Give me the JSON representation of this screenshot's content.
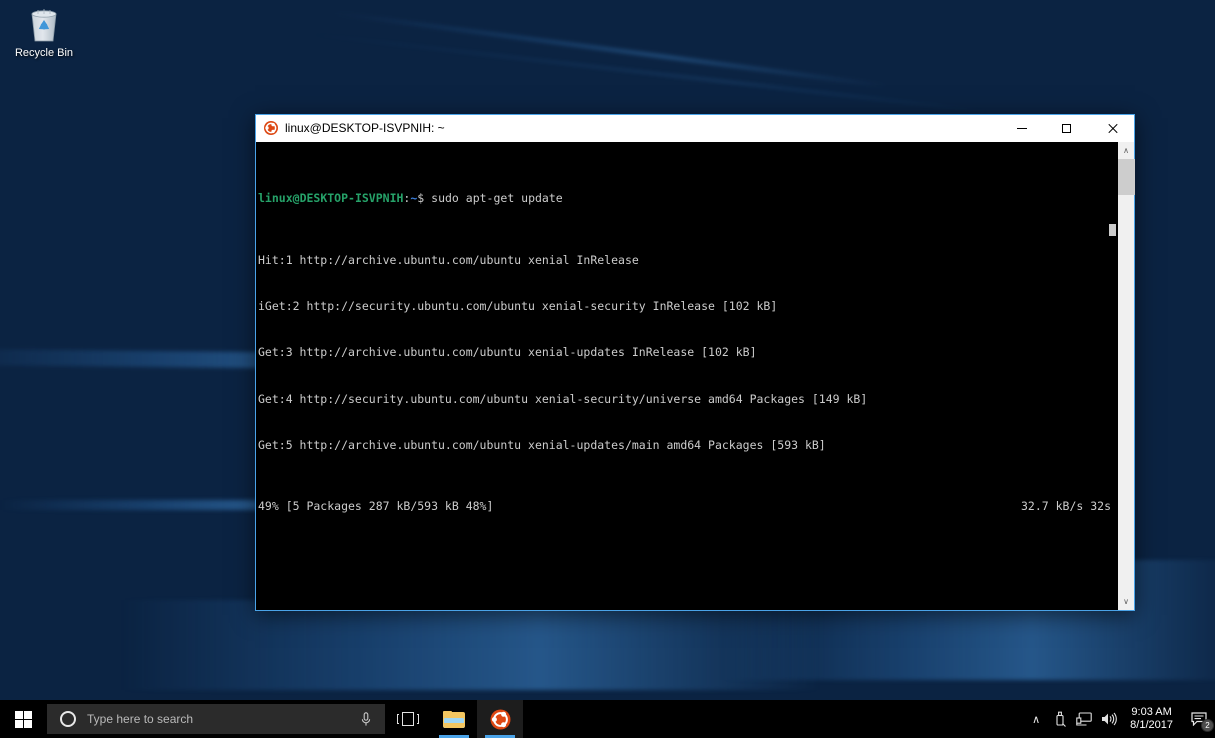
{
  "desktop": {
    "icons": [
      {
        "name": "recycle-bin",
        "label": "Recycle Bin"
      }
    ]
  },
  "window": {
    "title": "linux@DESKTOP-ISVPNIH: ~",
    "app_icon": "ubuntu-icon",
    "controls": {
      "minimize": "—",
      "maximize": "❑",
      "close": "✕"
    },
    "border_color": "#4aa3e8"
  },
  "terminal": {
    "background": "#000000",
    "foreground": "#cccccc",
    "prompt": {
      "user": "linux",
      "at": "@",
      "host": "DESKTOP-ISVPNIH",
      "colon": ":",
      "path": "~",
      "sigil": "$",
      "command": " sudo apt-get update"
    },
    "lines": [
      "Hit:1 http://archive.ubuntu.com/ubuntu xenial InRelease",
      "iGet:2 http://security.ubuntu.com/ubuntu xenial-security InRelease [102 kB]",
      "Get:3 http://archive.ubuntu.com/ubuntu xenial-updates InRelease [102 kB]",
      "Get:4 http://security.ubuntu.com/ubuntu xenial-security/universe amd64 Packages [149 kB]",
      "Get:5 http://archive.ubuntu.com/ubuntu xenial-updates/main amd64 Packages [593 kB]"
    ],
    "status": {
      "progress": "49% [5 Packages 287 kB/593 kB 48%]",
      "rate": "32.7 kB/s 32s"
    },
    "scrollbar": {
      "up_arrow": "∧",
      "down_arrow": "∨"
    }
  },
  "taskbar": {
    "start_label": "Start",
    "search": {
      "placeholder": "Type here to search",
      "cortana_icon": "cortana-circle-icon",
      "mic_icon": "microphone-icon"
    },
    "buttons": [
      {
        "name": "task-view-button",
        "label": "Task View"
      },
      {
        "name": "file-explorer-button",
        "label": "File Explorer"
      },
      {
        "name": "ubuntu-button",
        "label": "Ubuntu"
      }
    ],
    "tray": {
      "show_hidden_icons": "∧",
      "icons": [
        {
          "name": "usb-safely-remove-icon",
          "label": "Safely Remove Hardware"
        },
        {
          "name": "network-icon",
          "label": "Network"
        },
        {
          "name": "volume-icon",
          "label": "Volume"
        }
      ],
      "clock": {
        "time": "9:03 AM",
        "date": "8/1/2017"
      },
      "action_center": {
        "name": "action-center-icon",
        "badge": "2"
      }
    }
  }
}
